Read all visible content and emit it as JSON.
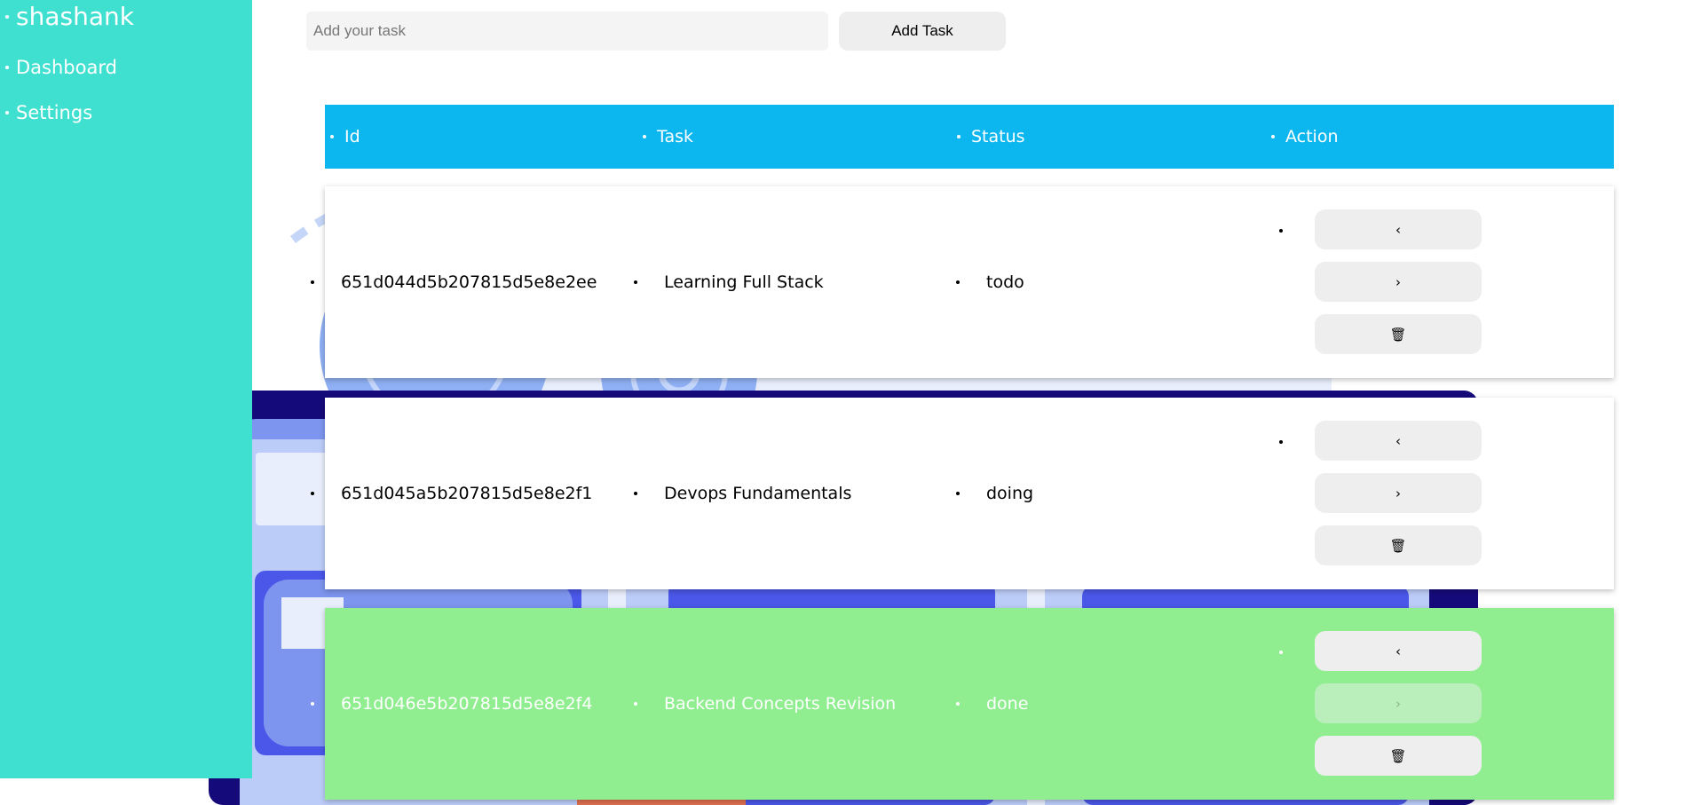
{
  "sidebar": {
    "brand": "shashank",
    "items": [
      {
        "label": "Dashboard"
      },
      {
        "label": "Settings"
      }
    ]
  },
  "form": {
    "placeholder": "Add your task",
    "value": "",
    "button": "Add Task"
  },
  "table": {
    "headers": [
      "Id",
      "Task",
      "Status",
      "Action"
    ],
    "rows": [
      {
        "id": "651d044d5b207815d5e8e2ee",
        "task": "Learning Full Stack",
        "status": "todo",
        "bg": "#ffffff",
        "actions": {
          "prev": "‹",
          "next": "›",
          "delete": "🗑"
        }
      },
      {
        "id": "651d045a5b207815d5e8e2f1",
        "task": "Devops Fundamentals",
        "status": "doing",
        "bg": "#ffffff",
        "actions": {
          "prev": "‹",
          "next": "›",
          "delete": "🗑"
        }
      },
      {
        "id": "651d046e5b207815d5e8e2f4",
        "task": "Backend Concepts Revision",
        "status": "done",
        "bg": "#90ee90",
        "actions": {
          "prev": "‹",
          "next": "›",
          "delete": "🗑"
        }
      }
    ]
  },
  "colors": {
    "sidebar": "#40e0d0",
    "header": "#0cb6ef",
    "done_row": "#90ee90"
  }
}
